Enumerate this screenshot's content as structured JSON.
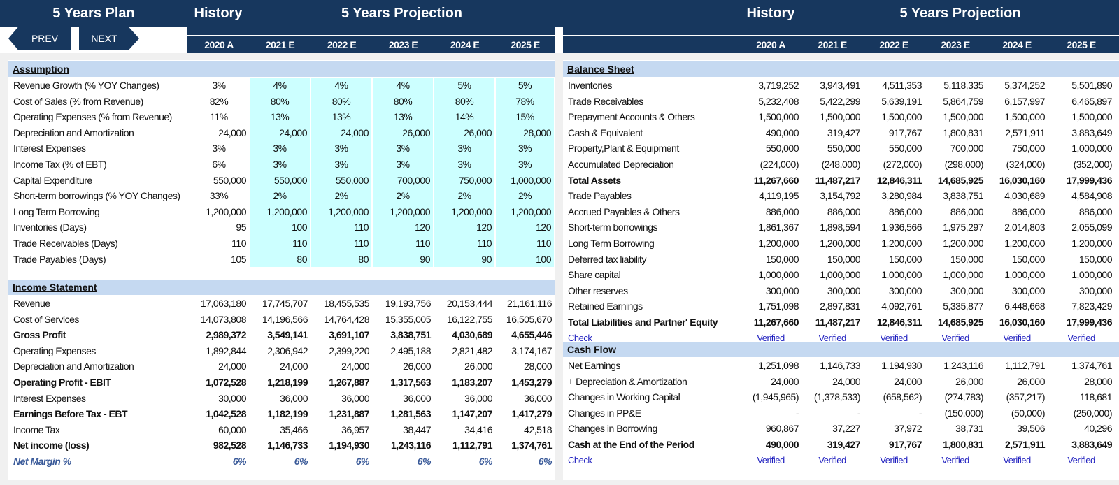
{
  "header": {
    "plan_title": "5 Years Plan",
    "history": "History",
    "projection": "5 Years Projection",
    "years": [
      "2020 A",
      "2021 E",
      "2022 E",
      "2023 E",
      "2024 E",
      "2025 E"
    ],
    "prev": "PREV",
    "next": "NEXT"
  },
  "assumption": {
    "title": "Assumption",
    "rows": [
      {
        "label": "Revenue Growth (% YOY Changes)",
        "values": [
          "3%",
          "4%",
          "4%",
          "4%",
          "5%",
          "5%"
        ]
      },
      {
        "label": "Cost of Sales (% from Revenue)",
        "values": [
          "82%",
          "80%",
          "80%",
          "80%",
          "80%",
          "78%"
        ]
      },
      {
        "label": "Operating Expenses (% from Revenue)",
        "values": [
          "11%",
          "13%",
          "13%",
          "13%",
          "14%",
          "15%"
        ]
      },
      {
        "label": "Depreciation and Amortization",
        "values": [
          "24,000",
          "24,000",
          "24,000",
          "26,000",
          "26,000",
          "28,000"
        ]
      },
      {
        "label": "Interest Expenses",
        "values": [
          "3%",
          "3%",
          "3%",
          "3%",
          "3%",
          "3%"
        ]
      },
      {
        "label": "Income Tax (% of EBT)",
        "values": [
          "6%",
          "3%",
          "3%",
          "3%",
          "3%",
          "3%"
        ]
      },
      {
        "label": "Capital Expenditure",
        "values": [
          "550,000",
          "550,000",
          "550,000",
          "700,000",
          "750,000",
          "1,000,000"
        ]
      },
      {
        "label": "Short-term borrowings (% YOY Changes)",
        "values": [
          "33%",
          "2%",
          "2%",
          "2%",
          "2%",
          "2%"
        ]
      },
      {
        "label": "Long Term Borrowing",
        "values": [
          "1,200,000",
          "1,200,000",
          "1,200,000",
          "1,200,000",
          "1,200,000",
          "1,200,000"
        ]
      },
      {
        "label": "Inventories (Days)",
        "values": [
          "95",
          "100",
          "110",
          "120",
          "120",
          "120"
        ]
      },
      {
        "label": "Trade Receivables (Days)",
        "values": [
          "110",
          "110",
          "110",
          "110",
          "110",
          "110"
        ]
      },
      {
        "label": "Trade Payables (Days)",
        "values": [
          "105",
          "80",
          "80",
          "90",
          "90",
          "100"
        ]
      }
    ]
  },
  "income": {
    "title": "Income Statement",
    "rows": [
      {
        "label": "Revenue",
        "values": [
          "17,063,180",
          "17,745,707",
          "18,455,535",
          "19,193,756",
          "20,153,444",
          "21,161,116"
        ]
      },
      {
        "label": "Cost of Services",
        "values": [
          "14,073,808",
          "14,196,566",
          "14,764,428",
          "15,355,005",
          "16,122,755",
          "16,505,670"
        ]
      },
      {
        "label": "Gross Profit",
        "values": [
          "2,989,372",
          "3,549,141",
          "3,691,107",
          "3,838,751",
          "4,030,689",
          "4,655,446"
        ],
        "bold": true
      },
      {
        "label": "Operating Expenses",
        "values": [
          "1,892,844",
          "2,306,942",
          "2,399,220",
          "2,495,188",
          "2,821,482",
          "3,174,167"
        ]
      },
      {
        "label": "Depreciation and Amortization",
        "values": [
          "24,000",
          "24,000",
          "24,000",
          "26,000",
          "26,000",
          "28,000"
        ]
      },
      {
        "label": "Operating Profit - EBIT",
        "values": [
          "1,072,528",
          "1,218,199",
          "1,267,887",
          "1,317,563",
          "1,183,207",
          "1,453,279"
        ],
        "bold": true
      },
      {
        "label": "Interest Expenses",
        "values": [
          "30,000",
          "36,000",
          "36,000",
          "36,000",
          "36,000",
          "36,000"
        ]
      },
      {
        "label": "Earnings Before Tax - EBT",
        "values": [
          "1,042,528",
          "1,182,199",
          "1,231,887",
          "1,281,563",
          "1,147,207",
          "1,417,279"
        ],
        "bold": true
      },
      {
        "label": "Income Tax",
        "values": [
          "60,000",
          "35,466",
          "36,957",
          "38,447",
          "34,416",
          "42,518"
        ]
      },
      {
        "label": "Net income (loss)",
        "values": [
          "982,528",
          "1,146,733",
          "1,194,930",
          "1,243,116",
          "1,112,791",
          "1,374,761"
        ],
        "bold": true
      },
      {
        "label": "Net Margin %",
        "values": [
          "6%",
          "6%",
          "6%",
          "6%",
          "6%",
          "6%"
        ],
        "margin": true
      }
    ]
  },
  "balance": {
    "title": "Balance Sheet",
    "rows": [
      {
        "label": "Inventories",
        "values": [
          "3,719,252",
          "3,943,491",
          "4,511,353",
          "5,118,335",
          "5,374,252",
          "5,501,890"
        ]
      },
      {
        "label": "Trade Receivables",
        "values": [
          "5,232,408",
          "5,422,299",
          "5,639,191",
          "5,864,759",
          "6,157,997",
          "6,465,897"
        ]
      },
      {
        "label": "Prepayment Accounts & Others",
        "values": [
          "1,500,000",
          "1,500,000",
          "1,500,000",
          "1,500,000",
          "1,500,000",
          "1,500,000"
        ]
      },
      {
        "label": "Cash  & Equivalent",
        "values": [
          "490,000",
          "319,427",
          "917,767",
          "1,800,831",
          "2,571,911",
          "3,883,649"
        ]
      },
      {
        "label": "Property,Plant & Equipment",
        "values": [
          "550,000",
          "550,000",
          "550,000",
          "700,000",
          "750,000",
          "1,000,000"
        ]
      },
      {
        "label": "Accumulated Depreciation",
        "values": [
          "(224,000)",
          "(248,000)",
          "(272,000)",
          "(298,000)",
          "(324,000)",
          "(352,000)"
        ]
      },
      {
        "label": "Total Assets",
        "values": [
          "11,267,660",
          "11,487,217",
          "12,846,311",
          "14,685,925",
          "16,030,160",
          "17,999,436"
        ],
        "bold": true
      },
      {
        "label": "Trade Payables",
        "values": [
          "4,119,195",
          "3,154,792",
          "3,280,984",
          "3,838,751",
          "4,030,689",
          "4,584,908"
        ]
      },
      {
        "label": "Accrued Payables & Others",
        "values": [
          "886,000",
          "886,000",
          "886,000",
          "886,000",
          "886,000",
          "886,000"
        ]
      },
      {
        "label": "Short-term borrowings",
        "values": [
          "1,861,367",
          "1,898,594",
          "1,936,566",
          "1,975,297",
          "2,014,803",
          "2,055,099"
        ]
      },
      {
        "label": "Long Term Borrowing",
        "values": [
          "1,200,000",
          "1,200,000",
          "1,200,000",
          "1,200,000",
          "1,200,000",
          "1,200,000"
        ]
      },
      {
        "label": "Deferred tax liability",
        "values": [
          "150,000",
          "150,000",
          "150,000",
          "150,000",
          "150,000",
          "150,000"
        ]
      },
      {
        "label": "Share capital",
        "values": [
          "1,000,000",
          "1,000,000",
          "1,000,000",
          "1,000,000",
          "1,000,000",
          "1,000,000"
        ]
      },
      {
        "label": "Other reserves",
        "values": [
          "300,000",
          "300,000",
          "300,000",
          "300,000",
          "300,000",
          "300,000"
        ]
      },
      {
        "label": "Retained Earnings",
        "values": [
          "1,751,098",
          "2,897,831",
          "4,092,761",
          "5,335,877",
          "6,448,668",
          "7,823,429"
        ]
      },
      {
        "label": "Total Liabilities and Partner' Equity",
        "values": [
          "11,267,660",
          "11,487,217",
          "12,846,311",
          "14,685,925",
          "16,030,160",
          "17,999,436"
        ],
        "bold": true
      },
      {
        "label": "Check",
        "values": [
          "Verified",
          "Verified",
          "Verified",
          "Verified",
          "Verified",
          "Verified"
        ],
        "check": true
      }
    ]
  },
  "cashflow": {
    "title": "Cash Flow",
    "rows": [
      {
        "label": "Net Earnings",
        "values": [
          "1,251,098",
          "1,146,733",
          "1,194,930",
          "1,243,116",
          "1,112,791",
          "1,374,761"
        ]
      },
      {
        "label": "+ Depreciation & Amortization",
        "values": [
          "24,000",
          "24,000",
          "24,000",
          "26,000",
          "26,000",
          "28,000"
        ]
      },
      {
        "label": "Changes in Working Capital",
        "values": [
          "(1,945,965)",
          "(1,378,533)",
          "(658,562)",
          "(274,783)",
          "(357,217)",
          "118,681"
        ]
      },
      {
        "label": "Changes in PP&E",
        "values": [
          "-",
          "-",
          "-",
          "(150,000)",
          "(50,000)",
          "(250,000)"
        ]
      },
      {
        "label": "Changes in Borrowing",
        "values": [
          "960,867",
          "37,227",
          "37,972",
          "38,731",
          "39,506",
          "40,296"
        ]
      },
      {
        "label": "Cash at the End of the Period",
        "values": [
          "490,000",
          "319,427",
          "917,767",
          "1,800,831",
          "2,571,911",
          "3,883,649"
        ],
        "bold": true
      },
      {
        "label": "Check",
        "values": [
          "Verified",
          "Verified",
          "Verified",
          "Verified",
          "Verified",
          "Verified"
        ],
        "check": true
      }
    ]
  },
  "colors": {
    "header_navy": "#17375e",
    "section_blue": "#c5d9f1",
    "input_cyan": "#ccffff",
    "verified_blue": "#1f1fbf"
  }
}
